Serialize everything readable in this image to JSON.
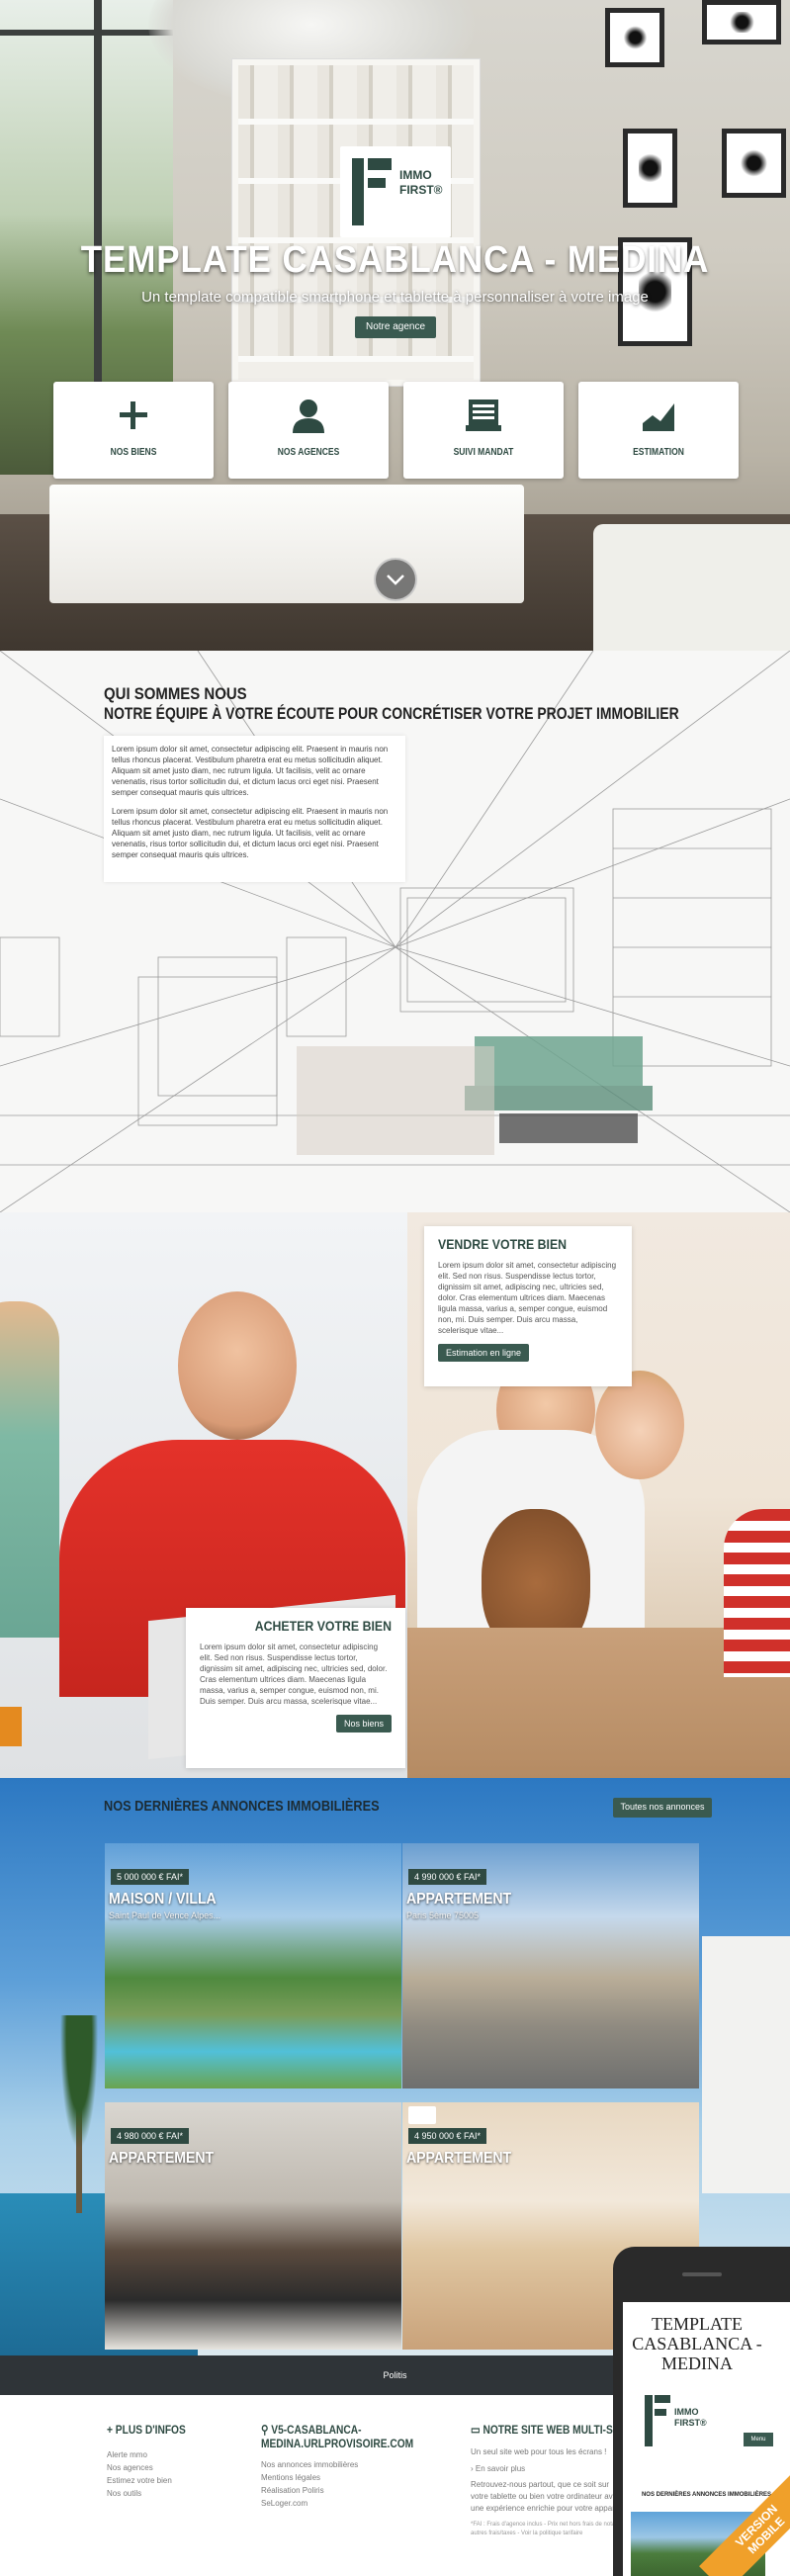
{
  "hero": {
    "logo_line1": "IMMO",
    "logo_line2": "FIRST®",
    "title": "TEMPLATE CASABLANCA - MEDINA",
    "subtitle": "Un template compatible smartphone et tablette à personnaliser à votre image",
    "cta": "Notre agence",
    "tiles": [
      {
        "label": "NOS BIENS",
        "icon": "plus-icon"
      },
      {
        "label": "NOS AGENCES",
        "icon": "person-icon"
      },
      {
        "label": "SUIVI MANDAT",
        "icon": "document-icon"
      },
      {
        "label": "ESTIMATION",
        "icon": "chart-icon"
      }
    ],
    "scroll_icon": "chevron-down-icon"
  },
  "about": {
    "title1": "QUI SOMMES NOUS",
    "title2": "NOTRE ÉQUIPE À VOTRE ÉCOUTE POUR CONCRÉTISER VOTRE PROJET IMMOBILIER",
    "paragraph1": "Lorem ipsum dolor sit amet, consectetur adipiscing elit. Praesent in mauris non tellus rhoncus placerat. Vestibulum pharetra erat eu metus sollicitudin aliquet. Aliquam sit amet justo diam, nec rutrum ligula. Ut facilisis, velit ac ornare venenatis, risus tortor sollicitudin dui, et dictum lacus orci eget nisi. Praesent semper consequat mauris quis ultrices.",
    "paragraph2": "Lorem ipsum dolor sit amet, consectetur adipiscing elit. Praesent in mauris non tellus rhoncus placerat. Vestibulum pharetra erat eu metus sollicitudin aliquet. Aliquam sit amet justo diam, nec rutrum ligula. Ut facilisis, velit ac ornare venenatis, risus tortor sollicitudin dui, et dictum lacus orci eget nisi. Praesent semper consequat mauris quis ultrices."
  },
  "sell": {
    "title": "VENDRE VOTRE BIEN",
    "text": "Lorem ipsum dolor sit amet, consectetur adipiscing elit. Sed non risus. Suspendisse lectus tortor, dignissim sit amet, adipiscing nec, ultricies sed, dolor. Cras elementum ultrices diam. Maecenas ligula massa, varius a, semper congue, euismod non, mi. Duis semper. Duis arcu massa, scelerisque vitae...",
    "button": "Estimation en ligne"
  },
  "buy": {
    "title": "ACHETER VOTRE BIEN",
    "text": "Lorem ipsum dolor sit amet, consectetur adipiscing elit. Sed non risus. Suspendisse lectus tortor, dignissim sit amet, adipiscing nec, ultricies sed, dolor. Cras elementum ultrices diam. Maecenas ligula massa, varius a, semper congue, euismod non, mi. Duis semper. Duis arcu massa, scelerisque vitae...",
    "button": "Nos biens"
  },
  "listings": {
    "title": "NOS DERNIÈRES ANNONCES IMMOBILIÈRES",
    "all_button": "Toutes nos annonces",
    "items": [
      {
        "price": "5 000 000 € FAI*",
        "type": "MAISON / VILLA",
        "location": "Saint Paul de Vence Alpes..."
      },
      {
        "price": "4 990 000 € FAI*",
        "type": "APPARTEMENT",
        "location": "Paris 5ème 75005"
      },
      {
        "price": "4 980 000 € FAI*",
        "type": "APPARTEMENT",
        "location": ""
      },
      {
        "price": "4 950 000 € FAI*",
        "type": "APPARTEMENT",
        "location": ""
      }
    ]
  },
  "footer": {
    "bar": "Politis",
    "col1_title": "PLUS D'INFOS",
    "col1_links": [
      "Alerte mmo",
      "Nos agences",
      "Estimez votre bien",
      "Nos outils"
    ],
    "col2_title_1": "V5-CASABLANCA-",
    "col2_title_2": "MEDINA.URLPROVISOIRE.COM",
    "col2_links": [
      "Nos annonces immobilières",
      "Mentions légales",
      "Réalisation Poliris",
      "SeLoger.com"
    ],
    "col3_title": "NOTRE SITE WEB MULTI-SUPPORT",
    "col3_text1": "Un seul site web pour tous les écrans !",
    "col3_link": "En savoir plus",
    "col3_text2": "Retrouvez-nous partout, que ce soit sur votre tablette ou bien votre ordinateur avec une expérience enrichie pour votre appareil.",
    "col3_note": "*FAI : Frais d'agence inclus - Prix net hors frais de notaire et autres frais/taxes - Voir la politique tarifaire"
  },
  "mobile": {
    "title_1": "TEMPLATE",
    "title_2": "CASABLANCA -",
    "title_3": "MEDINA",
    "logo_line1": "IMMO",
    "logo_line2": "FIRST®",
    "menu": "Menu",
    "list_title": "NOS DERNIÈRES ANNONCES IMMOBILIÈRES",
    "ribbon_1": "VERSION",
    "ribbon_2": "MOBILE"
  },
  "colors": {
    "accent": "#3a5a50",
    "brand": "#2e4a42",
    "footer_bar": "#2f3438",
    "ribbon": "#f0a02a"
  }
}
